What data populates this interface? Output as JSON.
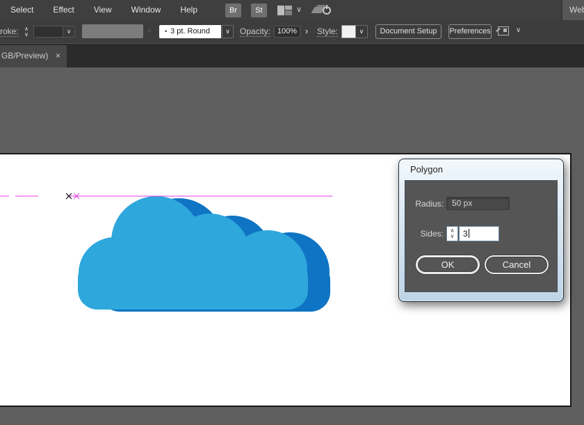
{
  "menubar": {
    "items": [
      "Select",
      "Effect",
      "View",
      "Window",
      "Help"
    ],
    "br_label": "Br",
    "st_label": "St",
    "workspace_right_label": "Web"
  },
  "optionsbar": {
    "stroke_label": "roke:",
    "brush_value": "3 pt. Round",
    "opacity_label": "Opacity:",
    "opacity_value": "100%",
    "style_label": "Style:",
    "document_setup_label": "Document Setup",
    "preferences_label": "Preferences"
  },
  "tabbar": {
    "tab_label": "GB/Preview)"
  },
  "dialog": {
    "title": "Polygon",
    "radius_label": "Radius:",
    "radius_value": "50 px",
    "sides_label": "Sides:",
    "sides_value": "3",
    "ok_label": "OK",
    "cancel_label": "Cancel"
  },
  "icons": {
    "chevron_down": "∨",
    "chevron_up": "∧",
    "chevron_right": "›",
    "close": "×",
    "bullet": "•"
  },
  "canvas": {
    "colors": {
      "cloud_light": "#2ea7dd",
      "cloud_dark": "#0f74c4",
      "guide_magenta": "#e03ce0",
      "anchor_black": "#111111"
    }
  }
}
